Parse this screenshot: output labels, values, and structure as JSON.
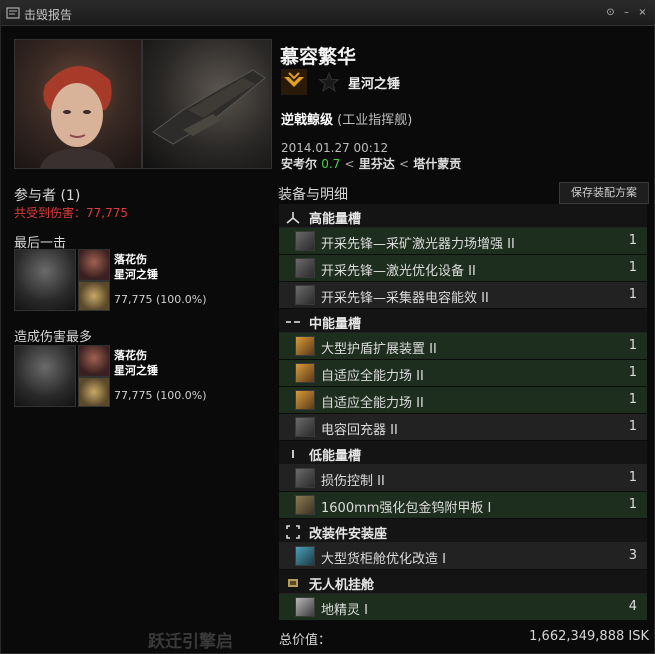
{
  "window": {
    "title": "击毁报告",
    "buttons": [
      "⊙",
      "–",
      "×"
    ]
  },
  "victim": {
    "name": "慕容繁华",
    "corp": "星河之锤",
    "ship_name": "逆戟鲸级",
    "ship_class": "(工业指挥舰)",
    "datetime": "2014.01.27 00:12",
    "system": "安考尔",
    "security": "0.7",
    "constellation": "里芬达",
    "region": "塔什蒙贡",
    "separator": "<"
  },
  "left": {
    "participants_label": "参与者 (1)",
    "damage_total_label": "共受到伤害：77,775",
    "final_blow_label": "最后一击",
    "top_damage_label": "造成伤害最多",
    "attackers": [
      {
        "name": "落花伤",
        "corp": "星河之锤",
        "damage": "77,775 (100.0%)"
      },
      {
        "name": "落花伤",
        "corp": "星河之锤",
        "damage": "77,775 (100.0%)"
      }
    ]
  },
  "fitting": {
    "heading": "装备与明细",
    "save_button": "保存装配方案",
    "groups": [
      {
        "label": "高能量槽",
        "icon": "high-slot-icon",
        "items": [
          {
            "name": "开采先锋—采矿激光器力场增强 II",
            "qty": "1",
            "icon": "mining-upgrade-icon",
            "style": "g"
          },
          {
            "name": "开采先锋—激光优化设备 II",
            "qty": "1",
            "icon": "mining-upgrade-icon",
            "style": "g"
          },
          {
            "name": "开采先锋—采集器电容能效 II",
            "qty": "1",
            "icon": "mining-upgrade-icon",
            "style": "d"
          }
        ]
      },
      {
        "label": "中能量槽",
        "icon": "mid-slot-icon",
        "items": [
          {
            "name": "大型护盾扩展装置 II",
            "qty": "1",
            "icon": "shield-extender-icon",
            "style": "g"
          },
          {
            "name": "自适应全能力场 II",
            "qty": "1",
            "icon": "shield-hardener-icon",
            "style": "g"
          },
          {
            "name": "自适应全能力场 II",
            "qty": "1",
            "icon": "shield-hardener-icon",
            "style": "g"
          },
          {
            "name": "电容回充器 II",
            "qty": "1",
            "icon": "cap-recharger-icon",
            "style": "d"
          }
        ]
      },
      {
        "label": "低能量槽",
        "icon": "low-slot-icon",
        "items": [
          {
            "name": "损伤控制 II",
            "qty": "1",
            "icon": "damage-control-icon",
            "style": "d"
          },
          {
            "name": "1600mm强化包金钨附甲板 I",
            "qty": "1",
            "icon": "armor-plate-icon",
            "style": "g"
          }
        ]
      },
      {
        "label": "改装件安装座",
        "icon": "rig-slot-icon",
        "items": [
          {
            "name": "大型货柜舱优化改造 I",
            "qty": "3",
            "icon": "cargo-rig-icon",
            "style": "d"
          }
        ]
      },
      {
        "label": "无人机挂舱",
        "icon": "drone-bay-icon",
        "items": [
          {
            "name": "地精灵 I",
            "qty": "4",
            "icon": "drone-icon",
            "style": "g"
          }
        ]
      }
    ],
    "total_label": "总价值：",
    "total_value": "1,662,349,888 ISK",
    "background_text": "跃迁引擎启"
  }
}
